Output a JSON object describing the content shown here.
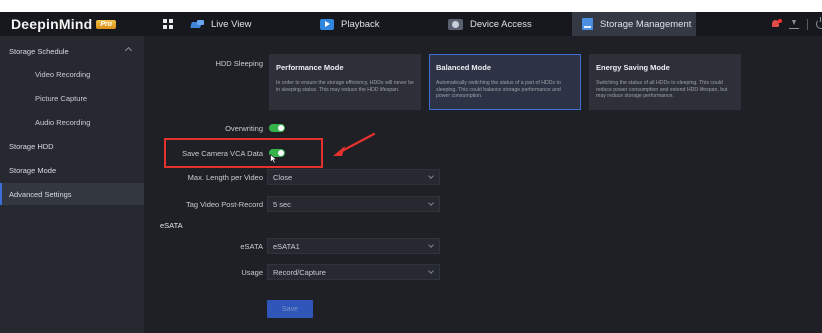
{
  "app": {
    "logo_text": "DeepinMind",
    "logo_badge": "Pro"
  },
  "nav": {
    "tabs": [
      {
        "label": "Live View",
        "icon": "live-view-icon"
      },
      {
        "label": "Playback",
        "icon": "playback-icon"
      },
      {
        "label": "Device Access",
        "icon": "device-access-icon"
      },
      {
        "label": "Storage Management",
        "icon": "storage-icon",
        "active": true
      }
    ]
  },
  "sidebar": {
    "items": [
      {
        "label": "Storage Schedule",
        "level": "top",
        "expanded": true
      },
      {
        "label": "Video Recording",
        "level": "sub"
      },
      {
        "label": "Picture Capture",
        "level": "sub"
      },
      {
        "label": "Audio Recording",
        "level": "sub"
      },
      {
        "label": "Storage HDD",
        "level": "top"
      },
      {
        "label": "Storage Mode",
        "level": "top"
      },
      {
        "label": "Advanced Settings",
        "level": "top",
        "active": true
      }
    ]
  },
  "form": {
    "hdd_sleeping": {
      "label": "HDD Sleeping",
      "modes": [
        {
          "title": "Performance Mode",
          "desc": "In order to ensure the storage efficiency, HDDs will never be in sleeping status. This may reduce the HDD lifespan.",
          "selected": false
        },
        {
          "title": "Balanced Mode",
          "desc": "Automatically switching the status of a part of HDDs to sleeping. This could balance storage performance and power consumption.",
          "selected": true
        },
        {
          "title": "Energy Saving Mode",
          "desc": "Switching the status of all HDDs to sleeping. This could reduce power consumption and extend HDD lifespan, but may reduce storage performance.",
          "selected": false
        }
      ]
    },
    "overwriting": {
      "label": "Overwriting",
      "on": true
    },
    "save_vca": {
      "label": "Save Camera VCA Data",
      "on": true
    },
    "max_length": {
      "label": "Max. Length per Video",
      "value": "Close"
    },
    "tag_post_record": {
      "label": "Tag Video Post-Record",
      "value": "5 sec"
    },
    "esata_section": "eSATA",
    "esata": {
      "label": "eSATA",
      "value": "eSATA1"
    },
    "usage": {
      "label": "Usage",
      "value": "Record/Capture"
    },
    "save_label": "Save"
  },
  "colors": {
    "accent": "#3b6ed8",
    "toggle_on": "#36b34b",
    "annotation": "#e6322e"
  }
}
